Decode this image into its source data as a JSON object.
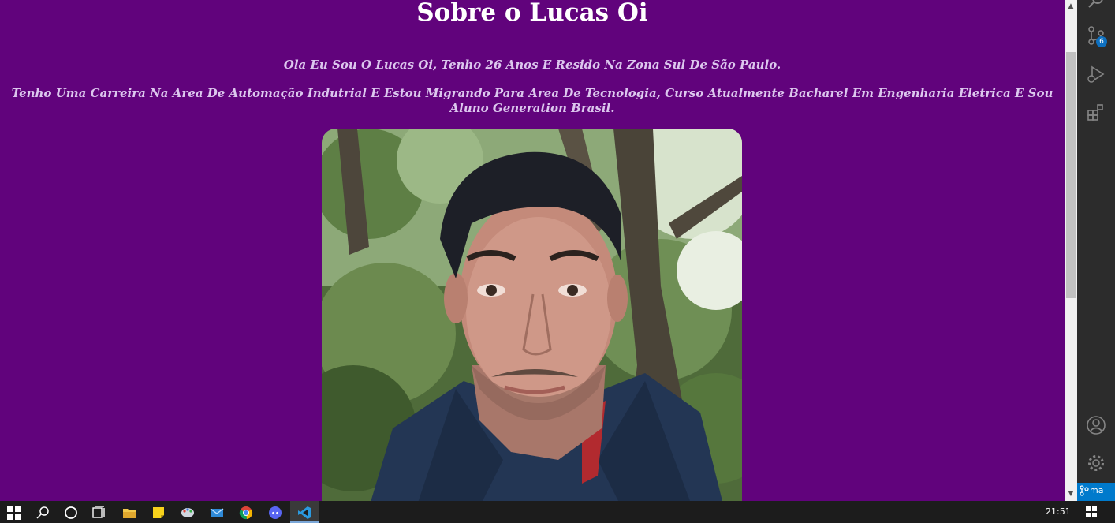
{
  "page": {
    "title": "Sobre o Lucas Oi",
    "intro": "Ola Eu Sou O Lucas Oi, Tenho 26 Anos E Resido Na Zona Sul De São Paulo.",
    "career": "Tenho Uma Carreira Na Area De Automação Indutrial E Estou Migrando Para Area De Tecnologia, Curso Atualmente Bacharel Em Engenharia Eletrica E Sou Aluno Generation Brasil.",
    "background_color": "#61037c",
    "text_color": "#dcc7ee"
  },
  "activity_bar": {
    "source_control_badge": "6",
    "status_branch": "ma"
  },
  "taskbar": {
    "clock": "21:51",
    "icons": [
      "windows-start-icon",
      "search-icon",
      "cortana-icon",
      "task-view-icon",
      "file-explorer-icon",
      "sticky-notes-icon",
      "paint-icon",
      "mail-icon",
      "chrome-icon",
      "discord-icon",
      "vscode-icon"
    ]
  }
}
